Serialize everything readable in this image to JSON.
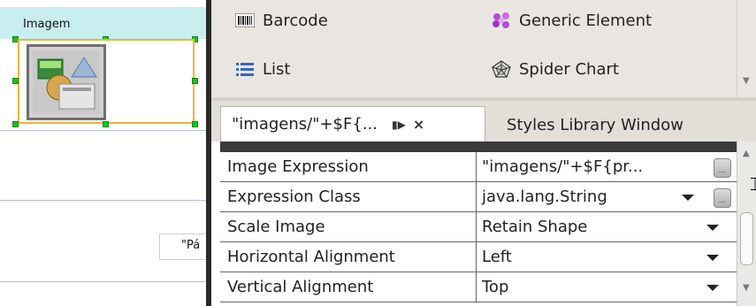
{
  "designer": {
    "band_title": "Imagem",
    "text_field_label": "\"Pá"
  },
  "palette": {
    "items": [
      {
        "label": "Barcode",
        "icon": "barcode-icon"
      },
      {
        "label": "Generic Element",
        "icon": "generic-element-icon"
      },
      {
        "label": "List",
        "icon": "list-icon"
      },
      {
        "label": "Spider Chart",
        "icon": "spider-chart-icon"
      }
    ]
  },
  "tabs": {
    "active": "\"imagens/\"+$F{...",
    "inactive": "Styles Library Window"
  },
  "properties": [
    {
      "name": "Image Expression",
      "value": "\"imagens/\"+$F{pr...",
      "control": "ellipsis"
    },
    {
      "name": "Expression Class",
      "value": "java.lang.String",
      "control": "dropdown+ellipsis"
    },
    {
      "name": "Scale Image",
      "value": "Retain Shape",
      "control": "dropdown"
    },
    {
      "name": "Horizontal Alignment",
      "value": "Left",
      "control": "dropdown"
    },
    {
      "name": "Vertical Alignment",
      "value": "Top",
      "control": "dropdown"
    }
  ],
  "colors": {
    "band_header": "#c8eef0",
    "selection_border": "#f0b43c",
    "handle": "#20c020",
    "band_line": "#b8b8ec"
  }
}
